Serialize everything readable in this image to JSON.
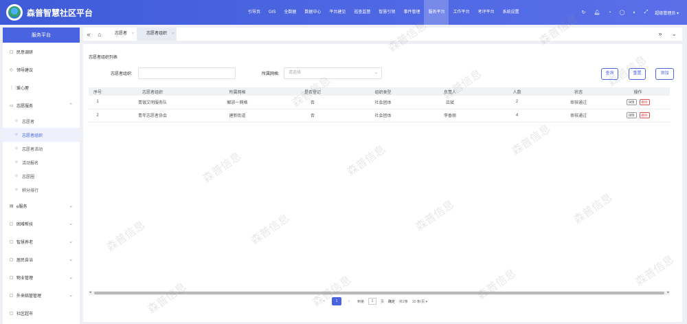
{
  "app": {
    "title": "森普智慧社区平台"
  },
  "topnav": [
    {
      "label": "引导页",
      "active": false
    },
    {
      "label": "GIS",
      "active": false
    },
    {
      "label": "全数据",
      "active": false
    },
    {
      "label": "数据中心",
      "active": false
    },
    {
      "label": "平台建见",
      "active": false
    },
    {
      "label": "巡查监督",
      "active": false
    },
    {
      "label": "智慧引领",
      "active": false
    },
    {
      "label": "事件管理",
      "active": false
    },
    {
      "label": "服务平台",
      "active": true
    },
    {
      "label": "工作平台",
      "active": false
    },
    {
      "label": "考评平台",
      "active": false
    },
    {
      "label": "系统设置",
      "active": false
    }
  ],
  "topbar": {
    "user_label": "超级管理员"
  },
  "sidebar": {
    "header": "服务平台",
    "items": [
      {
        "label": "民意调研",
        "icon": "◻"
      },
      {
        "label": "领导建议",
        "icon": "◇"
      },
      {
        "label": "爱心屋",
        "icon": "⋮⋮"
      },
      {
        "label": "志愿服务",
        "icon": "▭",
        "chevron": "⌃"
      },
      {
        "label": "e服务",
        "icon": "▤",
        "chevron": "⌄"
      },
      {
        "label": "困难帮扶",
        "icon": "◻",
        "chevron": "⌄"
      },
      {
        "label": "智慧养老",
        "icon": "◻",
        "chevron": "⌄"
      },
      {
        "label": "居民自治",
        "icon": "◻",
        "chevron": "⌄"
      },
      {
        "label": "物业管理",
        "icon": "◻",
        "chevron": "⌄"
      },
      {
        "label": "外来临管管理",
        "icon": "◻",
        "chevron": "⌄"
      },
      {
        "label": "社区超市",
        "icon": "◻"
      }
    ],
    "sub_items": [
      {
        "label": "志愿者",
        "active": false
      },
      {
        "label": "志愿者组织",
        "active": true
      },
      {
        "label": "志愿者活动",
        "active": false
      },
      {
        "label": "活动报名",
        "active": false
      },
      {
        "label": "志愿圈",
        "active": false
      },
      {
        "label": "积分排行",
        "active": false
      }
    ]
  },
  "tabs": [
    {
      "label": "志愿者",
      "active": false
    },
    {
      "label": "志愿者组织",
      "active": true
    }
  ],
  "main": {
    "section_title": "志愿者组织列表",
    "filter_name_label": "志愿者组织:",
    "filter_name_value": "",
    "filter_grid_label": "所属网格:",
    "filter_grid_placeholder": "请选择",
    "query_button": "查询",
    "reset_button": "重置",
    "add_button": "添加",
    "table": {
      "columns": [
        "序号",
        "志愿者组织",
        "所属网格",
        "是否登记",
        "组织类型",
        "负责人",
        "人数",
        "状态",
        "操作"
      ],
      "rows": [
        [
          "1",
          "青银文明服务队",
          "解放一网格",
          "否",
          "社会团体",
          "吕斌",
          "2",
          "审核通过"
        ],
        [
          "2",
          "青年志愿者协会",
          "建新街道",
          "否",
          "社会团体",
          "李香丽",
          "4",
          "审核通过"
        ]
      ],
      "op_detail": "详情",
      "op_delete": "删除"
    },
    "pagination": {
      "current_page": "1",
      "goto_label": "到第",
      "goto_value": "1",
      "page_unit": "页",
      "confirm": "确定",
      "total": "共2条",
      "page_size": "10 条/页"
    },
    "watermark": "森普信息"
  }
}
